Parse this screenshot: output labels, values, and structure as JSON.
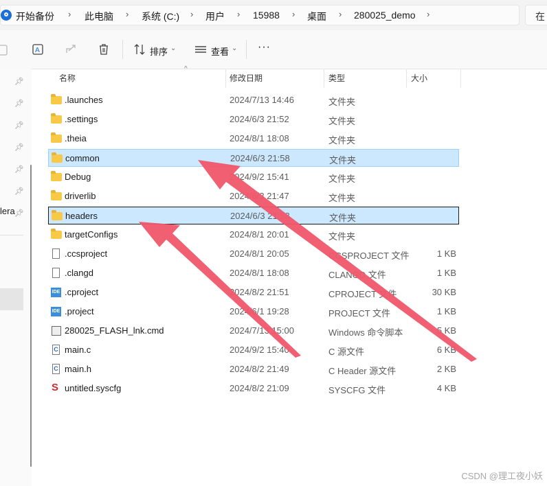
{
  "address": {
    "crumbs": [
      "开始备份",
      "此电脑",
      "系统 (C:)",
      "用户",
      "15988",
      "桌面",
      "280025_demo"
    ],
    "search_hint": "在"
  },
  "toolbar": {
    "sort_label": "排序",
    "view_label": "查看",
    "more_label": "···"
  },
  "nav": {
    "fragment": "lera"
  },
  "columns": {
    "name": "名称",
    "date": "修改日期",
    "type": "类型",
    "size": "大小"
  },
  "files": [
    {
      "name": ".launches",
      "date": "2024/7/13 14:46",
      "type": "文件夹",
      "size": "",
      "icon": "folder-icon"
    },
    {
      "name": ".settings",
      "date": "2024/6/3 21:52",
      "type": "文件夹",
      "size": "",
      "icon": "folder-icon"
    },
    {
      "name": ".theia",
      "date": "2024/8/1 18:08",
      "type": "文件夹",
      "size": "",
      "icon": "folder-icon"
    },
    {
      "name": "common",
      "date": "2024/6/3 21:58",
      "type": "文件夹",
      "size": "",
      "icon": "folder-icon",
      "selected": true
    },
    {
      "name": "Debug",
      "date": "2024/9/2 15:41",
      "type": "文件夹",
      "size": "",
      "icon": "folder-icon"
    },
    {
      "name": "driverlib",
      "date": "2024/6/3 21:47",
      "type": "文件夹",
      "size": "",
      "icon": "folder-icon"
    },
    {
      "name": "headers",
      "date": "2024/6/3 21:58",
      "type": "文件夹",
      "size": "",
      "icon": "folder-icon",
      "selected": true,
      "focused": true
    },
    {
      "name": "targetConfigs",
      "date": "2024/8/1 20:01",
      "type": "文件夹",
      "size": "",
      "icon": "folder-icon"
    },
    {
      "name": ".ccsproject",
      "date": "2024/8/1 20:05",
      "type": "CCSPROJECT 文件",
      "size": "1 KB",
      "icon": "file-icon"
    },
    {
      "name": ".clangd",
      "date": "2024/8/1 18:08",
      "type": "CLANGD 文件",
      "size": "1 KB",
      "icon": "file-icon"
    },
    {
      "name": ".cproject",
      "date": "2024/8/2 21:51",
      "type": "CPROJECT 文件",
      "size": "30 KB",
      "icon": "ide-icon"
    },
    {
      "name": ".project",
      "date": "2024/6/1 19:28",
      "type": "PROJECT 文件",
      "size": "1 KB",
      "icon": "ide-icon"
    },
    {
      "name": "280025_FLASH_lnk.cmd",
      "date": "2024/7/13 15:00",
      "type": "Windows 命令脚本",
      "size": "5 KB",
      "icon": "cmd-icon"
    },
    {
      "name": "main.c",
      "date": "2024/9/2 15:40",
      "type": "C 源文件",
      "size": "6 KB",
      "icon": "c-file-icon"
    },
    {
      "name": "main.h",
      "date": "2024/8/2 21:49",
      "type": "C Header 源文件",
      "size": "2 KB",
      "icon": "c-file-icon"
    },
    {
      "name": "untitled.syscfg",
      "date": "2024/8/2 21:09",
      "type": "SYSCFG 文件",
      "size": "4 KB",
      "icon": "syscfg-icon"
    }
  ],
  "colors": {
    "selection": "#cce8ff",
    "arrow": "#f0566a",
    "folder": "#f8c847"
  },
  "watermark": "CSDN @理工夜小妖"
}
